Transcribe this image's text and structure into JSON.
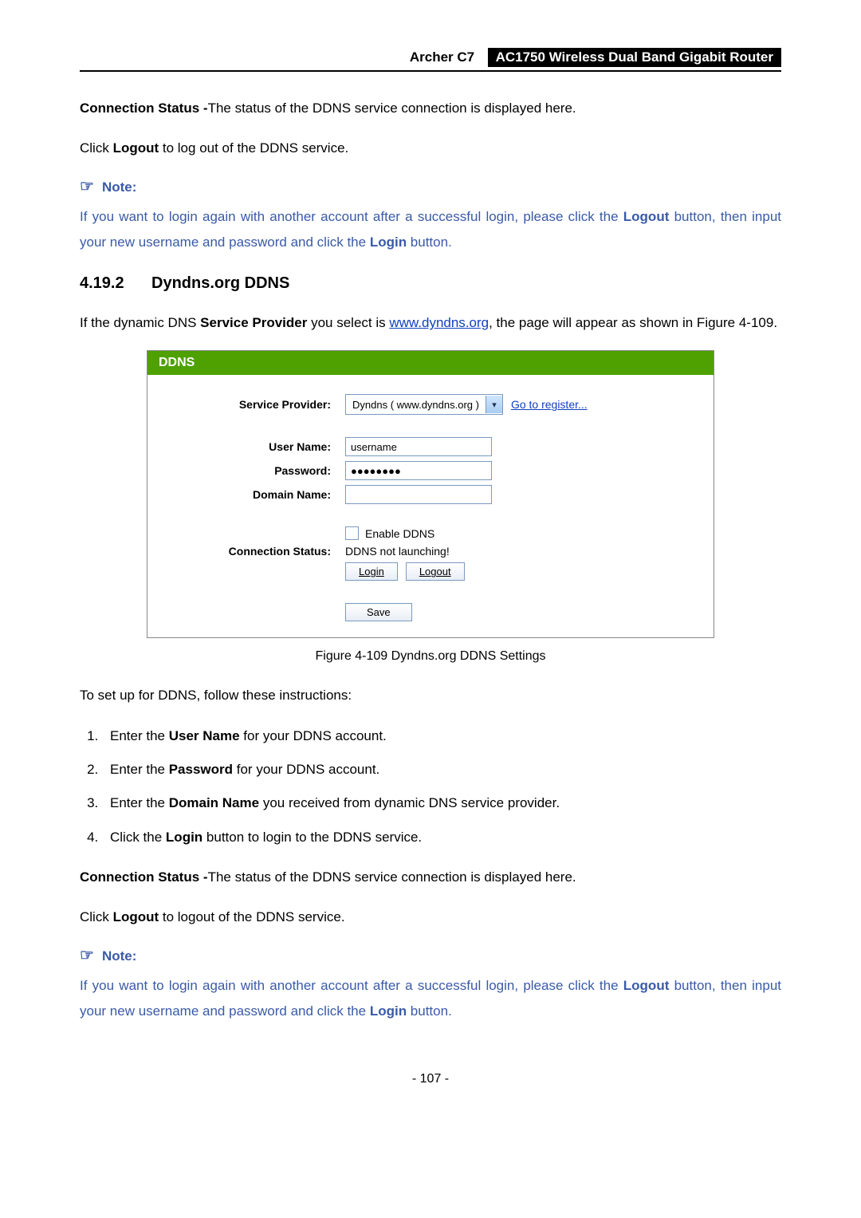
{
  "header": {
    "model": "Archer C7",
    "title": "AC1750 Wireless Dual Band Gigabit Router"
  },
  "para1_prefix_bold": "Connection Status -",
  "para1_rest": "The status of the DDNS service connection is displayed here.",
  "para2_a": "Click ",
  "para2_b_bold": "Logout",
  "para2_c": " to log out of the DDNS service.",
  "note_label": "Note:",
  "note1_a": " If you want to login again with another account after a successful login, please click the ",
  "note1_b_bold": "Logout",
  "note1_c": " button, then input your new username and password and click the ",
  "note1_d_bold": "Login",
  "note1_e": " button.",
  "section": {
    "num": "4.19.2",
    "title": "Dyndns.org DDNS"
  },
  "intro_a": "If the dynamic DNS ",
  "intro_b_bold": "Service Provider",
  "intro_c": " you select is ",
  "intro_link_text": "www.dyndns.org",
  "intro_d": ", the page will appear as shown in Figure 4-109.",
  "panel": {
    "title": "DDNS",
    "labels": {
      "service_provider": "Service Provider:",
      "user_name": "User Name:",
      "password": "Password:",
      "domain_name": "Domain Name:",
      "connection_status": "Connection Status:"
    },
    "service_provider_value": "Dyndns ( www.dyndns.org )",
    "register_link": "Go to register...",
    "user_name_value": "username",
    "password_value": "●●●●●●●●",
    "domain_name_value": "",
    "enable_label": "Enable DDNS",
    "status_text": "DDNS not launching!",
    "login_btn": "Login",
    "logout_btn": "Logout",
    "save_btn": "Save"
  },
  "figure_caption": "Figure 4-109 Dyndns.org DDNS Settings",
  "setup_intro": "To set up for DDNS, follow these instructions:",
  "steps": [
    {
      "a": "Enter the ",
      "b_bold": "User Name",
      "c": " for your DDNS account."
    },
    {
      "a": "Enter the ",
      "b_bold": "Password",
      "c": " for your DDNS account."
    },
    {
      "a": "Enter the ",
      "b_bold": "Domain Name",
      "c": " you received from dynamic DNS service provider."
    },
    {
      "a": "Click the ",
      "b_bold": "Login",
      "c": " button to login to the DDNS service."
    }
  ],
  "para3_prefix_bold": "Connection Status -",
  "para3_rest": "The status of the DDNS service connection is displayed here.",
  "para4_a": "Click ",
  "para4_b_bold": "Logout",
  "para4_c": " to logout of the DDNS service.",
  "note2_a": " If you want to login again with another account after a successful login, please click the ",
  "note2_b_bold": "Logout",
  "note2_c": " button, then input your new username and password and click the ",
  "note2_d_bold": "Login",
  "note2_e": " button.",
  "page_number": "- 107 -"
}
